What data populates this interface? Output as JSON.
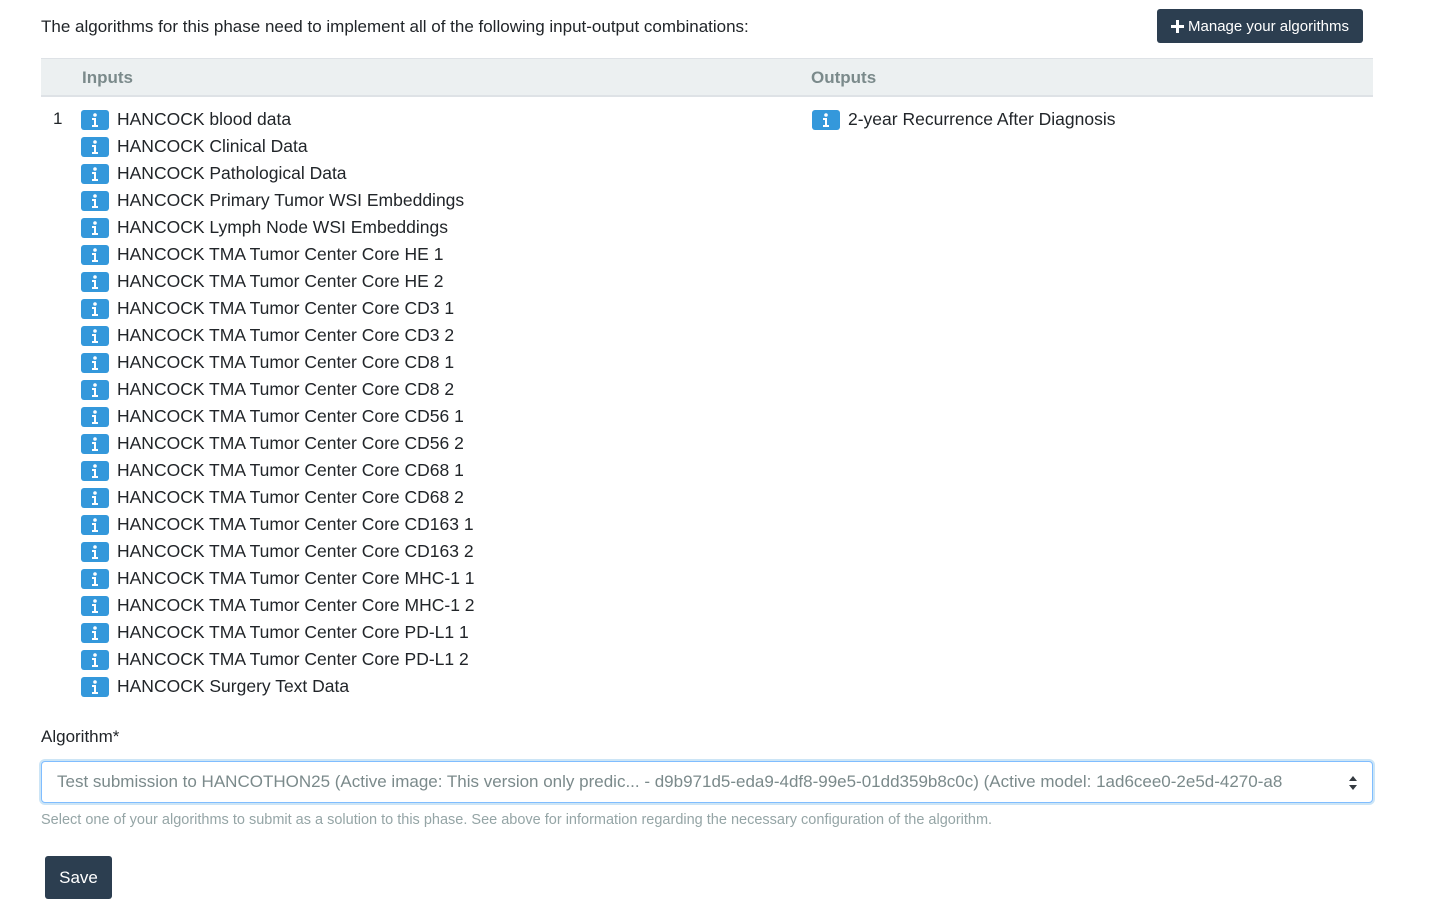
{
  "intro_text": "The algorithms for this phase need to implement all of the following input-output combinations:",
  "manage_button_label": "Manage your algorithms",
  "table": {
    "header_inputs": "Inputs",
    "header_outputs": "Outputs",
    "row_number": "1",
    "inputs": [
      "HANCOCK blood data",
      "HANCOCK Clinical Data",
      "HANCOCK Pathological Data",
      "HANCOCK Primary Tumor WSI Embeddings",
      "HANCOCK Lymph Node WSI Embeddings",
      "HANCOCK TMA Tumor Center Core HE 1",
      "HANCOCK TMA Tumor Center Core HE 2",
      "HANCOCK TMA Tumor Center Core CD3 1",
      "HANCOCK TMA Tumor Center Core CD3 2",
      "HANCOCK TMA Tumor Center Core CD8 1",
      "HANCOCK TMA Tumor Center Core CD8 2",
      "HANCOCK TMA Tumor Center Core CD56 1",
      "HANCOCK TMA Tumor Center Core CD56 2",
      "HANCOCK TMA Tumor Center Core CD68 1",
      "HANCOCK TMA Tumor Center Core CD68 2",
      "HANCOCK TMA Tumor Center Core CD163 1",
      "HANCOCK TMA Tumor Center Core CD163 2",
      "HANCOCK TMA Tumor Center Core MHC-1 1",
      "HANCOCK TMA Tumor Center Core MHC-1 2",
      "HANCOCK TMA Tumor Center Core PD-L1 1",
      "HANCOCK TMA Tumor Center Core PD-L1 2",
      "HANCOCK Surgery Text Data"
    ],
    "outputs": [
      "2-year Recurrence After Diagnosis"
    ]
  },
  "algorithm": {
    "label": "Algorithm*",
    "selected_value": "Test submission to HANCOTHON25 (Active image: This version only predic... - d9b971d5-eda9-4df8-99e5-01dd359b8c0c) (Active model: 1ad6cee0-2e5d-4270-a8",
    "help_text": "Select one of your algorithms to submit as a solution to this phase. See above for information regarding the necessary configuration of the algorithm."
  },
  "save_button_label": "Save",
  "colors": {
    "dark_button": "#2c3e50",
    "info_badge": "#3498db",
    "table_header_bg": "#ecf0f1"
  },
  "icons": {
    "info": "info-icon",
    "plus": "plus-icon",
    "select_arrows": "sort-arrows-icon"
  }
}
